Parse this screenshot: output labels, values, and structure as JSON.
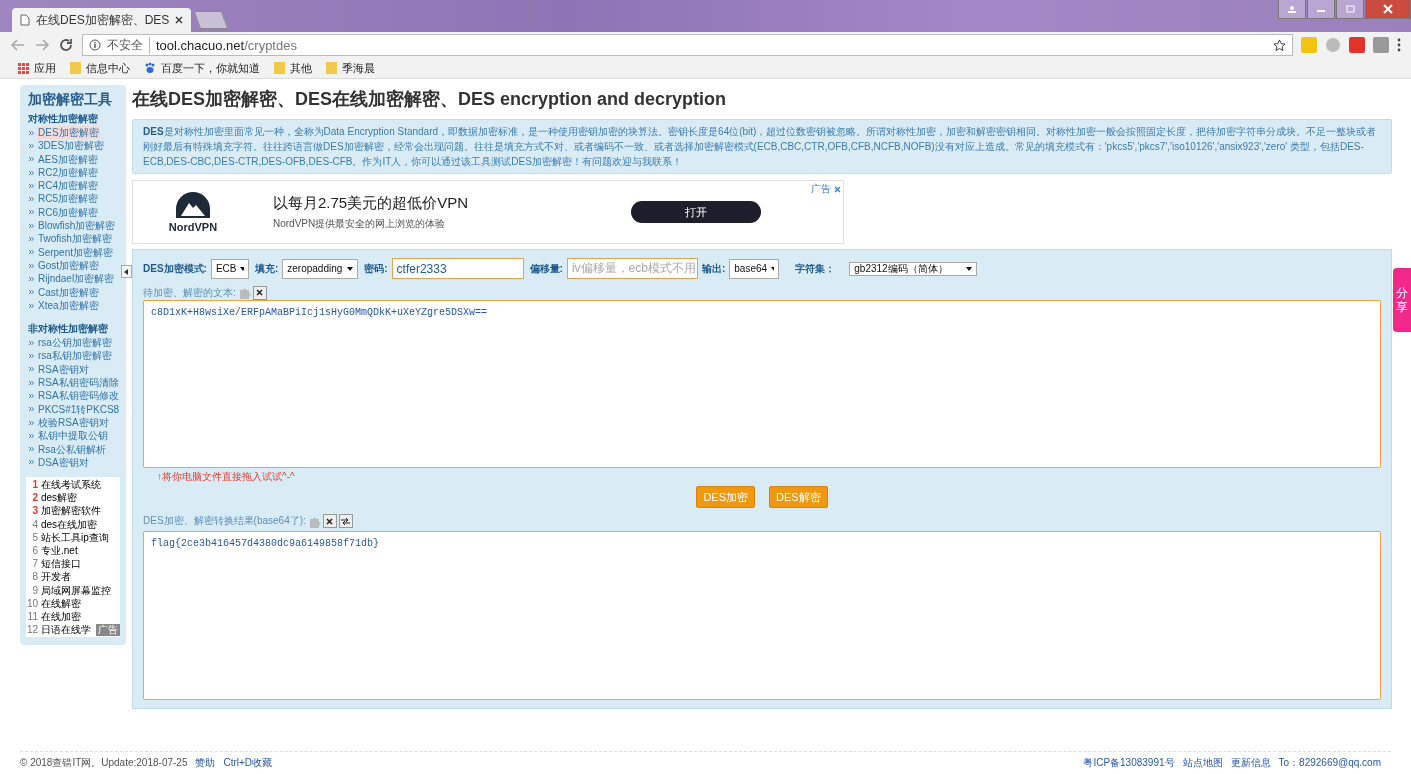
{
  "browser": {
    "tab_title": "在线DES加密解密、DES",
    "url_security": "不安全",
    "url_host": "tool.chacuo.net",
    "url_path": "/cryptdes",
    "bookmarks": [
      {
        "kind": "apps",
        "label": "应用"
      },
      {
        "kind": "folder",
        "label": "信息中心"
      },
      {
        "kind": "paw",
        "label": "百度一下，你就知道"
      },
      {
        "kind": "folder",
        "label": "其他"
      },
      {
        "kind": "folder",
        "label": "季海晨"
      }
    ]
  },
  "sidebar": {
    "title": "加密解密工具",
    "groups": [
      {
        "heading": "对称性加密解密",
        "items": [
          {
            "label": "DES加密解密",
            "selected": true
          },
          {
            "label": "3DES加密解密",
            "selected": false
          },
          {
            "label": "AES加密解密",
            "selected": false
          },
          {
            "label": "RC2加密解密",
            "selected": false
          },
          {
            "label": "RC4加密解密",
            "selected": false
          },
          {
            "label": "RC5加密解密",
            "selected": false
          },
          {
            "label": "RC6加密解密",
            "selected": false
          },
          {
            "label": "Blowfish加密解密",
            "selected": false
          },
          {
            "label": "Twofish加密解密",
            "selected": false
          },
          {
            "label": "Serpent加密解密",
            "selected": false
          },
          {
            "label": "Gost加密解密",
            "selected": false
          },
          {
            "label": "Rijndael加密解密",
            "selected": false
          },
          {
            "label": "Cast加密解密",
            "selected": false
          },
          {
            "label": "Xtea加密解密",
            "selected": false
          }
        ]
      },
      {
        "heading": "非对称性加密解密",
        "items": [
          {
            "label": "rsa公钥加密解密",
            "selected": false
          },
          {
            "label": "rsa私钥加密解密",
            "selected": false
          },
          {
            "label": "RSA密钥对",
            "selected": false
          },
          {
            "label": "RSA私钥密码清除",
            "selected": false
          },
          {
            "label": "RSA私钥密码修改",
            "selected": false
          },
          {
            "label": "PKCS#1转PKCS8",
            "selected": false
          },
          {
            "label": "校验RSA密钥对",
            "selected": false
          },
          {
            "label": "私钥中提取公钥",
            "selected": false
          },
          {
            "label": "Rsa公私钥解析",
            "selected": false
          },
          {
            "label": "DSA密钥对",
            "selected": false
          }
        ]
      }
    ],
    "ad_list": [
      {
        "rank": "1",
        "label": "在线考试系统",
        "hot": true
      },
      {
        "rank": "2",
        "label": "des解密",
        "hot": true
      },
      {
        "rank": "3",
        "label": "加密解密软件",
        "hot": true
      },
      {
        "rank": "4",
        "label": "des在线加密",
        "hot": false
      },
      {
        "rank": "5",
        "label": "站长工具ip查询",
        "hot": false
      },
      {
        "rank": "6",
        "label": "专业.net",
        "hot": false
      },
      {
        "rank": "7",
        "label": "短信接口",
        "hot": false
      },
      {
        "rank": "8",
        "label": "开发者",
        "hot": false
      },
      {
        "rank": "9",
        "label": "局域网屏幕监控",
        "hot": false
      },
      {
        "rank": "10",
        "label": "在线解密",
        "hot": false
      },
      {
        "rank": "11",
        "label": "在线加密",
        "hot": false
      },
      {
        "rank": "12",
        "label": "日语在线学",
        "hot": false
      }
    ],
    "ad_badge": "广告"
  },
  "page_title": "在线DES加密解密、DES在线加密解密、DES encryption and decryption",
  "intro": "**DES**是对称性加密里面常见一种，全称为Data Encryption Standard，即数据加密标准，是一种使用密钥加密的块算法。密钥长度是64位(bit)，超过位数密钥被忽略。所谓对称性加密，加密和解密密钥相同。对称性加密一般会按照固定长度，把待加密字符串分成块。不足一整块或者刚好最后有特殊填充字符。往往跨语言做DES加密解密，经常会出现问题。往往是填充方式不对、或者编码不一致、或者选择加密解密模式(ECB,CBC,CTR,OFB,CFB,NCFB,NOFB)没有对应上造成。常见的填充模式有：'pkcs5','pkcs7','iso10126','ansix923','zero' 类型，包括DES-ECB,DES-CBC,DES-CTR,DES-OFB,DES-CFB。作为IT人，你可以通过该工具测试DES加密解密！有问题欢迎与我联系！",
  "ad": {
    "label": "广告",
    "brand": "NordVPN",
    "headline": "以每月2.75美元的超低价VPN",
    "subline": "NordVPN提供最安全的网上浏览的体验",
    "button": "打开"
  },
  "form": {
    "mode_label": "DES加密模式:",
    "mode": "ECB",
    "padding_label": "填充:",
    "padding": "zeropadding",
    "key_label": "密码:",
    "key": "ctfer2333",
    "iv_label": "偏移量:",
    "iv_placeholder": "iv偏移量，ecb模式不用",
    "output_label": "输出:",
    "output": "base64",
    "charset_label": "字符集：",
    "charset": "gb2312编码（简体）",
    "input_label": "待加密、解密的文本:",
    "input": "c8D1xK+H8wsiXe/ERFpAMaBPiIcj1sHyG0MmQDkK+uXeYZgre5DSXw==",
    "drop_hint": "↑将你电脑文件直接拖入试试^-^",
    "buttons": [
      "DES加密",
      "DES解密"
    ],
    "result_label": "DES加密、解密转换结果(base64了):",
    "result": "flag{2ce3b416457d4380dc9a6149858f71db}"
  },
  "share": "分享",
  "footer": {
    "copyright": "© 2018查错IT网。Update:2018-07-25",
    "links_left": [
      "赞助",
      "Ctrl+D收藏"
    ],
    "icp": "粤ICP备13083991号",
    "links_right": [
      "站点地图",
      "更新信息"
    ],
    "contact": "To：8292669@qq.com"
  }
}
